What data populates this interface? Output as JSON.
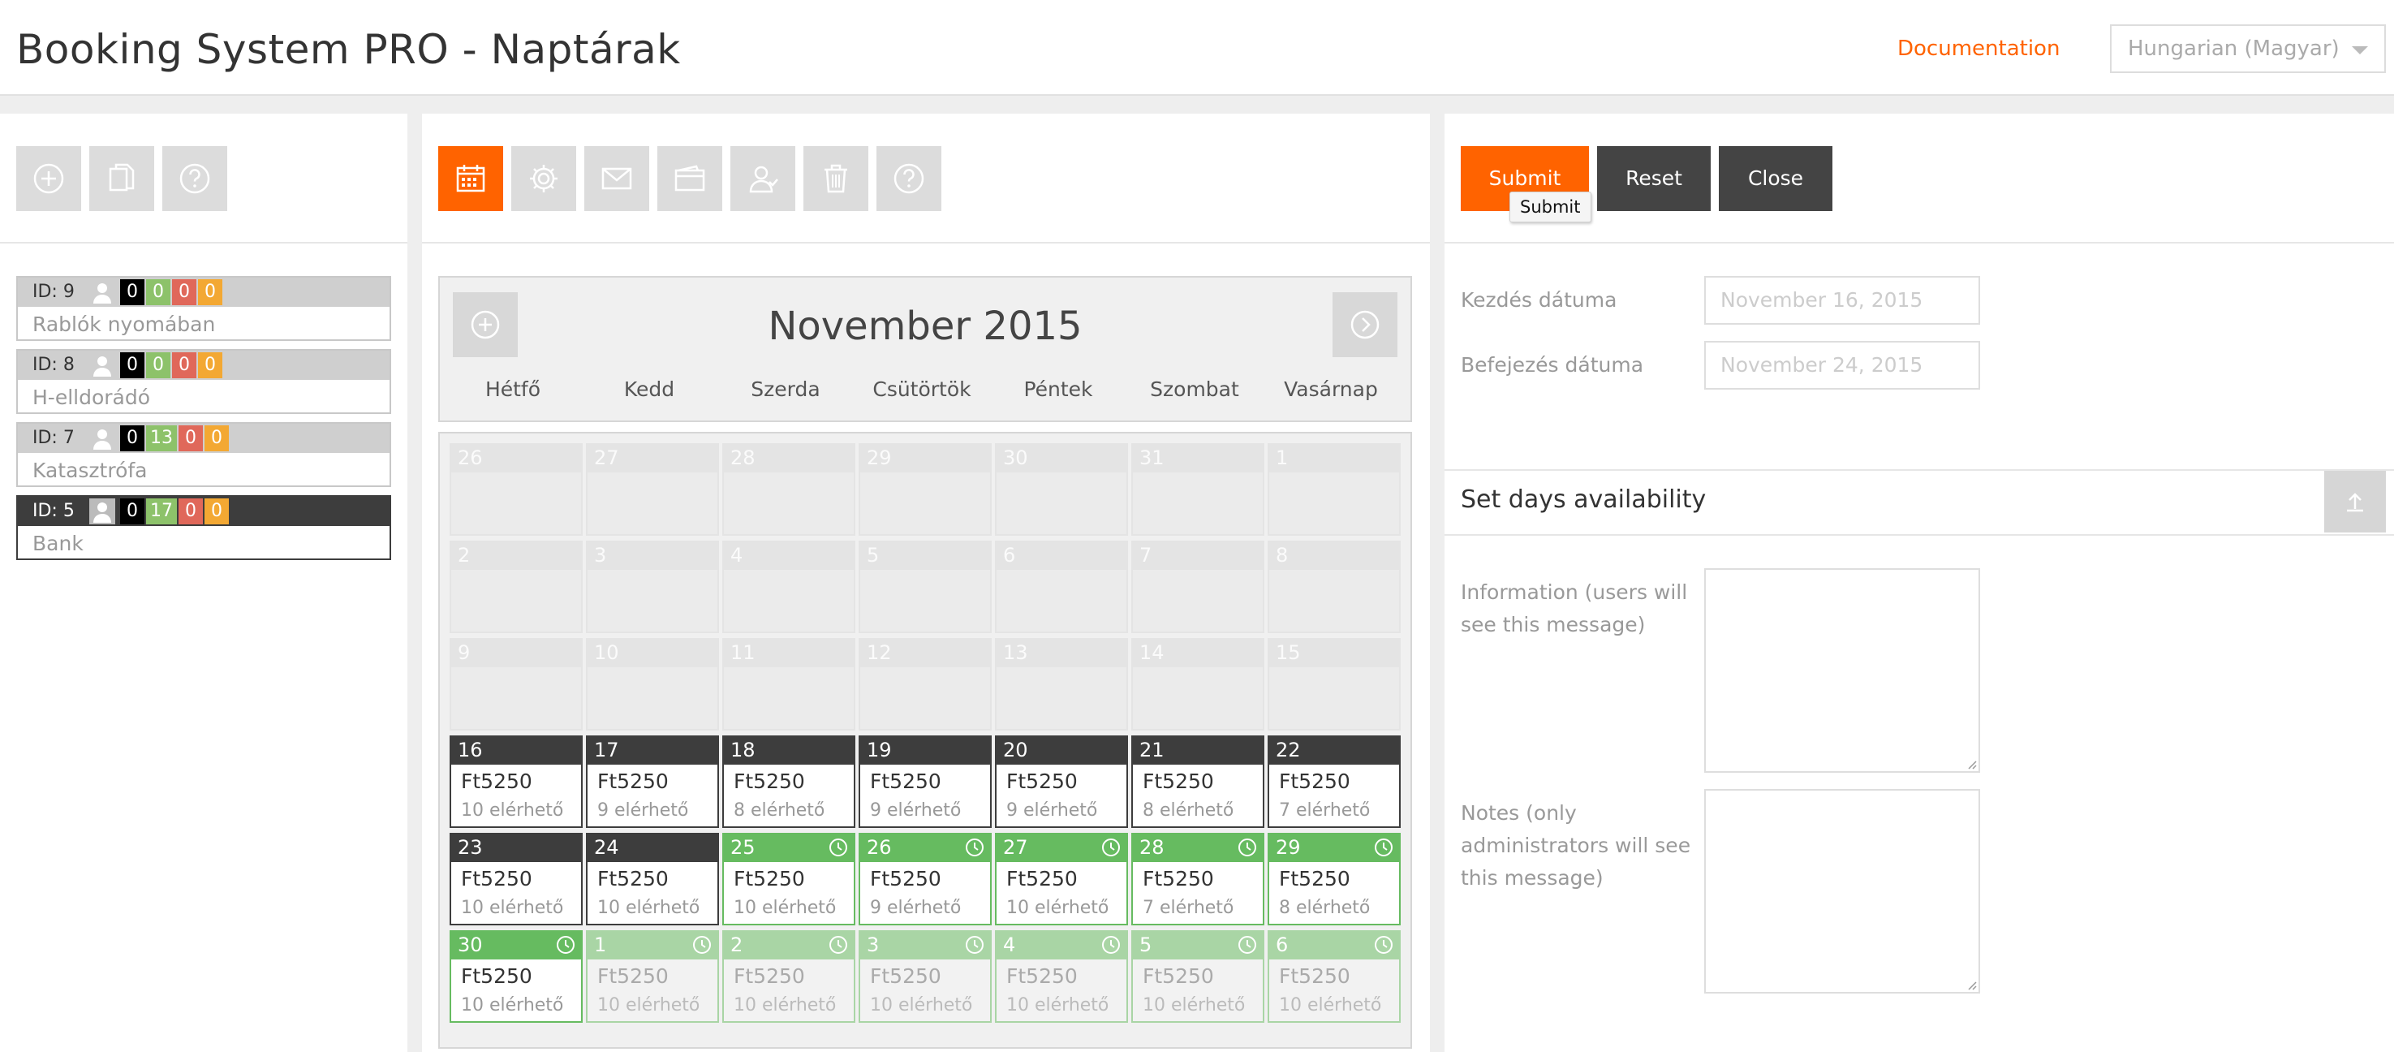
{
  "header": {
    "title": "Booking System PRO - Naptárak",
    "documentation": "Documentation",
    "language": "Hungarian (Magyar)"
  },
  "calendars": [
    {
      "id": "ID: 9",
      "name": "Rablók nyomában",
      "badges": [
        "0",
        "0",
        "0",
        "0"
      ],
      "selected": false
    },
    {
      "id": "ID: 8",
      "name": "H-elldorádó",
      "badges": [
        "0",
        "0",
        "0",
        "0"
      ],
      "selected": false
    },
    {
      "id": "ID: 7",
      "name": "Katasztrófa",
      "badges": [
        "0",
        "13",
        "0",
        "0"
      ],
      "selected": false
    },
    {
      "id": "ID: 5",
      "name": "Bank",
      "badges": [
        "0",
        "17",
        "0",
        "0"
      ],
      "selected": true
    }
  ],
  "calendar": {
    "month": "November 2015",
    "day_names": [
      "Hétfő",
      "Kedd",
      "Szerda",
      "Csütörtök",
      "Péntek",
      "Szombat",
      "Vasárnap"
    ],
    "weeks": [
      [
        {
          "d": "26",
          "s": "past"
        },
        {
          "d": "27",
          "s": "past"
        },
        {
          "d": "28",
          "s": "past"
        },
        {
          "d": "29",
          "s": "past"
        },
        {
          "d": "30",
          "s": "past"
        },
        {
          "d": "31",
          "s": "past"
        },
        {
          "d": "1",
          "s": "past"
        }
      ],
      [
        {
          "d": "2",
          "s": "past"
        },
        {
          "d": "3",
          "s": "past"
        },
        {
          "d": "4",
          "s": "past"
        },
        {
          "d": "5",
          "s": "past"
        },
        {
          "d": "6",
          "s": "past"
        },
        {
          "d": "7",
          "s": "past"
        },
        {
          "d": "8",
          "s": "past"
        }
      ],
      [
        {
          "d": "9",
          "s": "past"
        },
        {
          "d": "10",
          "s": "past"
        },
        {
          "d": "11",
          "s": "past"
        },
        {
          "d": "12",
          "s": "past"
        },
        {
          "d": "13",
          "s": "past"
        },
        {
          "d": "14",
          "s": "past"
        },
        {
          "d": "15",
          "s": "past"
        }
      ],
      [
        {
          "d": "16",
          "s": "dark",
          "p": "Ft5250",
          "a": "10 elérhető"
        },
        {
          "d": "17",
          "s": "dark",
          "p": "Ft5250",
          "a": "9 elérhető"
        },
        {
          "d": "18",
          "s": "dark",
          "p": "Ft5250",
          "a": "8 elérhető"
        },
        {
          "d": "19",
          "s": "dark",
          "p": "Ft5250",
          "a": "9 elérhető"
        },
        {
          "d": "20",
          "s": "dark",
          "p": "Ft5250",
          "a": "9 elérhető"
        },
        {
          "d": "21",
          "s": "dark",
          "p": "Ft5250",
          "a": "8 elérhető"
        },
        {
          "d": "22",
          "s": "dark",
          "p": "Ft5250",
          "a": "7 elérhető"
        }
      ],
      [
        {
          "d": "23",
          "s": "dark",
          "p": "Ft5250",
          "a": "10 elérhető"
        },
        {
          "d": "24",
          "s": "dark",
          "p": "Ft5250",
          "a": "10 elérhető"
        },
        {
          "d": "25",
          "s": "green",
          "p": "Ft5250",
          "a": "10 elérhető"
        },
        {
          "d": "26",
          "s": "green",
          "p": "Ft5250",
          "a": "9 elérhető"
        },
        {
          "d": "27",
          "s": "green",
          "p": "Ft5250",
          "a": "10 elérhető"
        },
        {
          "d": "28",
          "s": "green",
          "p": "Ft5250",
          "a": "7 elérhető"
        },
        {
          "d": "29",
          "s": "green",
          "p": "Ft5250",
          "a": "8 elérhető"
        }
      ],
      [
        {
          "d": "30",
          "s": "green",
          "p": "Ft5250",
          "a": "10 elérhető"
        },
        {
          "d": "1",
          "s": "lgreen",
          "p": "Ft5250",
          "a": "10 elérhető"
        },
        {
          "d": "2",
          "s": "lgreen",
          "p": "Ft5250",
          "a": "10 elérhető"
        },
        {
          "d": "3",
          "s": "lgreen",
          "p": "Ft5250",
          "a": "10 elérhető"
        },
        {
          "d": "4",
          "s": "lgreen",
          "p": "Ft5250",
          "a": "10 elérhető"
        },
        {
          "d": "5",
          "s": "lgreen",
          "p": "Ft5250",
          "a": "10 elérhető"
        },
        {
          "d": "6",
          "s": "lgreen",
          "p": "Ft5250",
          "a": "10 elérhető"
        }
      ]
    ]
  },
  "form": {
    "submit": "Submit",
    "reset": "Reset",
    "close": "Close",
    "tooltip": "Submit",
    "start_label": "Kezdés dátuma",
    "start_value": "November 16, 2015",
    "end_label": "Befejezés dátuma",
    "end_value": "November 24, 2015",
    "section_title": "Set days availability",
    "info_label": "Information (users will see this message)",
    "notes_label": "Notes (only administrators will see this message)"
  },
  "colors": {
    "accent": "#ff6300",
    "dark": "#3d3d3d",
    "available": "#66bb60"
  }
}
